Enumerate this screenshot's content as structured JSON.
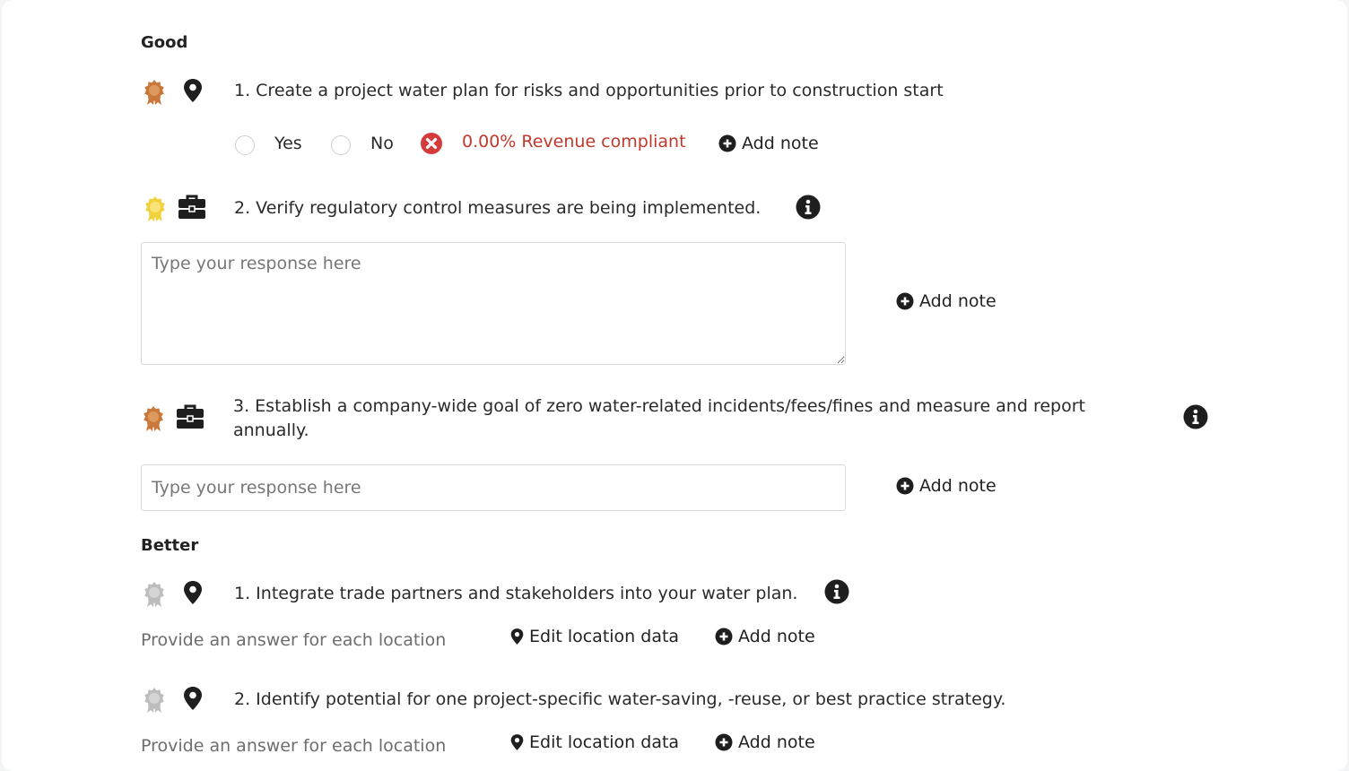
{
  "sections": [
    {
      "title": "Good",
      "questions": [
        {
          "text": "1. Create a project water plan for risks and opportunities prior to construction start",
          "medal_color": "#c9783a",
          "type_icon": "map-pin-icon",
          "options": [
            "Yes",
            "No"
          ],
          "compliance": "0.00% Revenue compliant",
          "add_note": "Add note"
        },
        {
          "text": "2. Verify regulatory control measures are being implemented.",
          "medal_color": "#f2d23c",
          "type_icon": "briefcase-icon",
          "placeholder": "Type your response here",
          "add_note": "Add note"
        },
        {
          "text_line1": "3. Establish a company-wide goal of zero water-related incidents/fees/fines and measure and report",
          "text_line2": "annually.",
          "medal_color": "#c9783a",
          "type_icon": "briefcase-icon",
          "placeholder": "Type your response here",
          "add_note": "Add note"
        }
      ]
    },
    {
      "title": "Better",
      "questions": [
        {
          "text": "1. Integrate trade partners and stakeholders into your water plan.",
          "medal_color": "#bdbdbd",
          "type_icon": "map-pin-icon",
          "hint": "Provide an answer for each location",
          "edit_location": "Edit location data",
          "add_note": "Add note"
        },
        {
          "text": "2. Identify potential for one project-specific water-saving, -reuse, or best practice strategy.",
          "medal_color": "#bdbdbd",
          "type_icon": "map-pin-icon",
          "hint": "Provide an answer for each location",
          "edit_location": "Edit location data",
          "add_note": "Add note"
        }
      ]
    }
  ],
  "colors": {
    "error_red": "#c0392b",
    "error_icon_red": "#d63b3b",
    "text_dark": "#222222",
    "muted": "#6d6d6d"
  }
}
